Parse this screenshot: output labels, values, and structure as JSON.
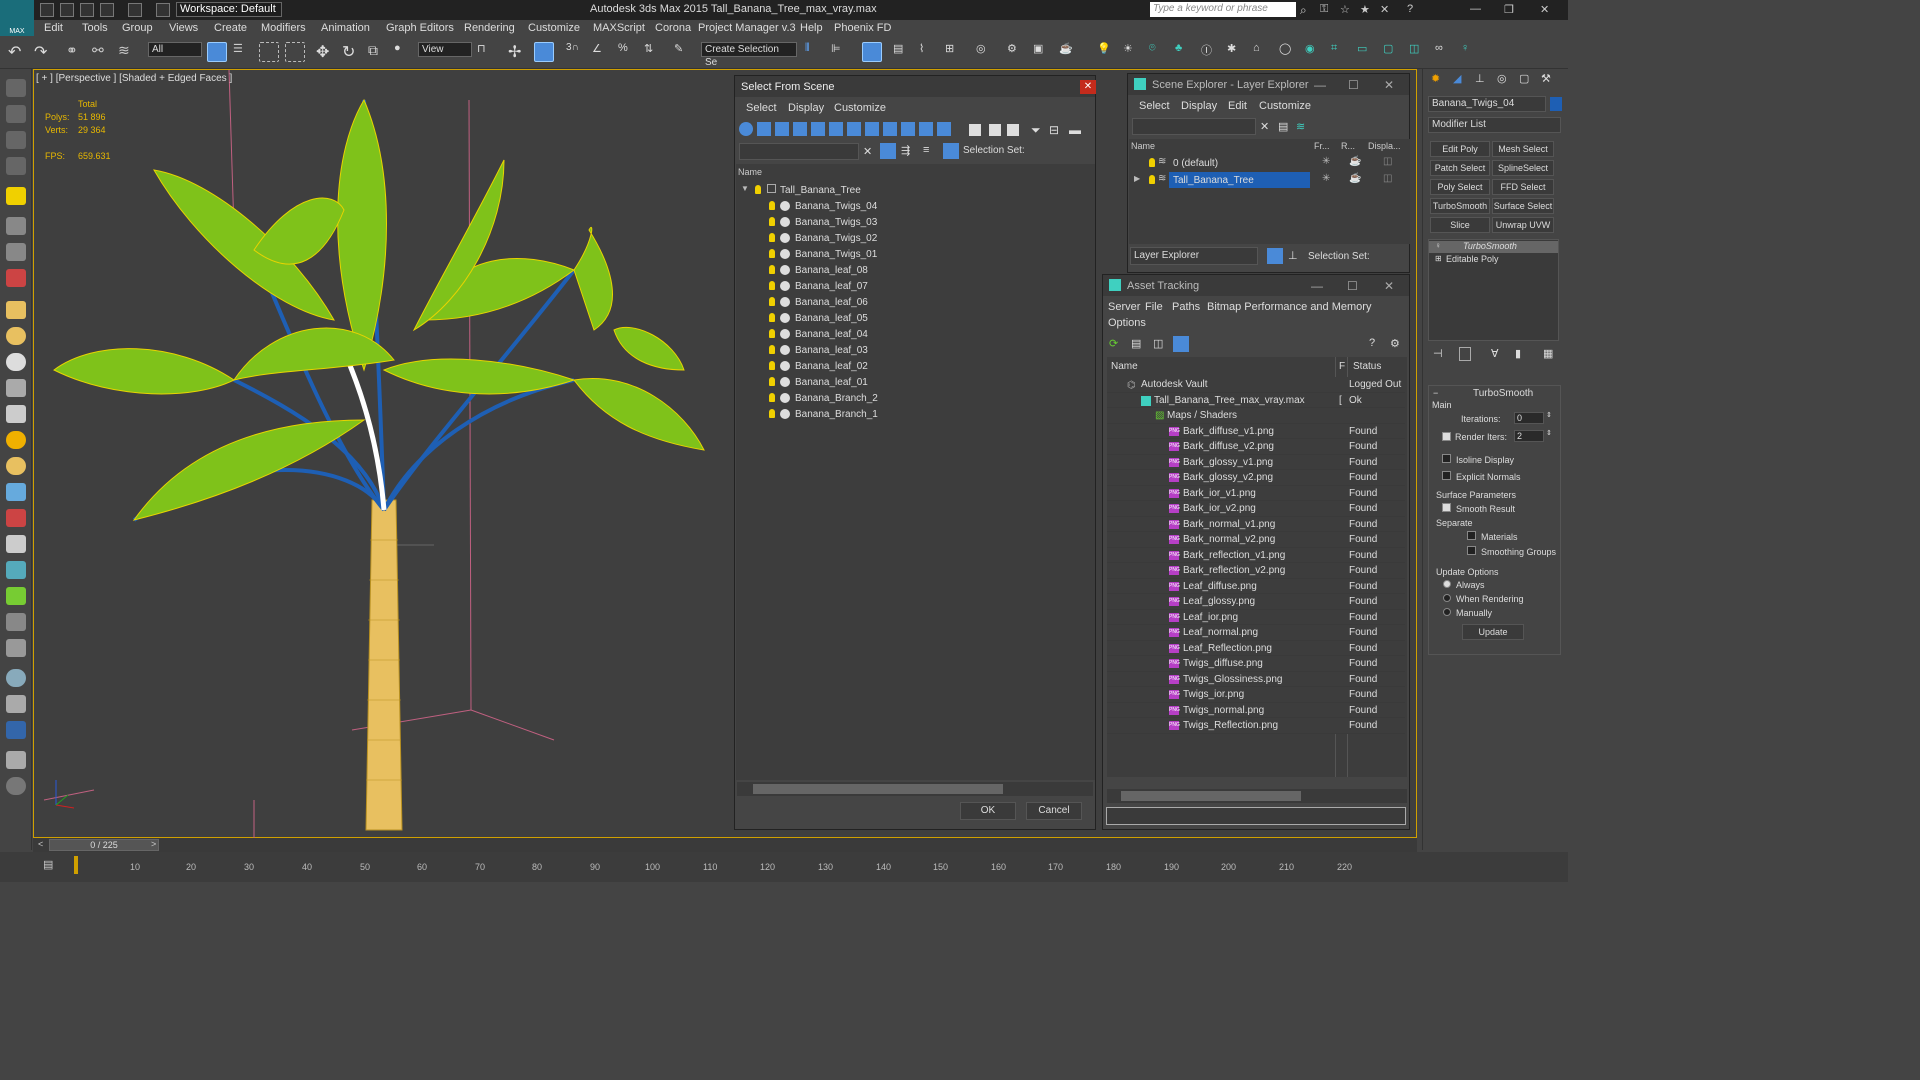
{
  "app": {
    "title": "Autodesk 3ds Max  2015     Tall_Banana_Tree_max_vray.max",
    "logo": "MAX",
    "workspace": "Workspace: Default",
    "search_placeholder": "Type a keyword or phrase"
  },
  "menu": [
    "Edit",
    "Tools",
    "Group",
    "Views",
    "Create",
    "Modifiers",
    "Animation",
    "Graph Editors",
    "Rendering",
    "Customize",
    "MAXScript",
    "Corona",
    "Project Manager v.3",
    "Help",
    "Phoenix FD"
  ],
  "toolbar": {
    "filter": "All",
    "view": "View",
    "selection_set": "Create Selection Se"
  },
  "viewport": {
    "label": "[ + ] [Perspective ] [Shaded + Edged Faces ]",
    "stats": {
      "total_label": "Total",
      "polys_label": "Polys:",
      "polys": "51 896",
      "verts_label": "Verts:",
      "verts": "29 364",
      "fps_label": "FPS:",
      "fps": "659.631"
    }
  },
  "select_from_scene": {
    "title": "Select From Scene",
    "menu": [
      "Select",
      "Display",
      "Customize"
    ],
    "selection_set_label": "Selection Set:",
    "column_name": "Name",
    "root": "Tall_Banana_Tree",
    "items": [
      "Banana_Twigs_04",
      "Banana_Twigs_03",
      "Banana_Twigs_02",
      "Banana_Twigs_01",
      "Banana_leaf_08",
      "Banana_leaf_07",
      "Banana_leaf_06",
      "Banana_leaf_05",
      "Banana_leaf_04",
      "Banana_leaf_03",
      "Banana_leaf_02",
      "Banana_leaf_01",
      "Banana_Branch_2",
      "Banana_Branch_1"
    ],
    "ok": "OK",
    "cancel": "Cancel"
  },
  "scene_explorer": {
    "title": "Scene Explorer - Layer Explorer",
    "menu": [
      "Select",
      "Display",
      "Edit",
      "Customize"
    ],
    "columns": [
      "Name",
      "Fr...",
      "R...",
      "Displa..."
    ],
    "layers": [
      "0 (default)",
      "Tall_Banana_Tree"
    ],
    "footer_dropdown": "Layer Explorer",
    "selection_set_label": "Selection Set:"
  },
  "asset_tracking": {
    "title": "Asset Tracking",
    "menu": [
      "Server",
      "File",
      "Paths",
      "Bitmap Performance and Memory"
    ],
    "menu2": "Options",
    "columns": [
      "Name",
      "F",
      "Status"
    ],
    "vault": {
      "name": "Autodesk Vault",
      "status": "Logged Out"
    },
    "file": {
      "name": "Tall_Banana_Tree_max_vray.max",
      "flag": "[",
      "status": "Ok"
    },
    "maps_label": "Maps / Shaders",
    "png_badge": "PNG",
    "maps": [
      {
        "name": "Bark_diffuse_v1.png",
        "status": "Found"
      },
      {
        "name": "Bark_diffuse_v2.png",
        "status": "Found"
      },
      {
        "name": "Bark_glossy_v1.png",
        "status": "Found"
      },
      {
        "name": "Bark_glossy_v2.png",
        "status": "Found"
      },
      {
        "name": "Bark_ior_v1.png",
        "status": "Found"
      },
      {
        "name": "Bark_ior_v2.png",
        "status": "Found"
      },
      {
        "name": "Bark_normal_v1.png",
        "status": "Found"
      },
      {
        "name": "Bark_normal_v2.png",
        "status": "Found"
      },
      {
        "name": "Bark_reflection_v1.png",
        "status": "Found"
      },
      {
        "name": "Bark_reflection_v2.png",
        "status": "Found"
      },
      {
        "name": "Leaf_diffuse.png",
        "status": "Found"
      },
      {
        "name": "Leaf_glossy.png",
        "status": "Found"
      },
      {
        "name": "Leaf_ior.png",
        "status": "Found"
      },
      {
        "name": "Leaf_normal.png",
        "status": "Found"
      },
      {
        "name": "Leaf_Reflection.png",
        "status": "Found"
      },
      {
        "name": "Twigs_diffuse.png",
        "status": "Found"
      },
      {
        "name": "Twigs_Glossiness.png",
        "status": "Found"
      },
      {
        "name": "Twigs_ior.png",
        "status": "Found"
      },
      {
        "name": "Twigs_normal.png",
        "status": "Found"
      },
      {
        "name": "Twigs_Reflection.png",
        "status": "Found"
      }
    ]
  },
  "command_panel": {
    "object_name": "Banana_Twigs_04",
    "modifier_list": "Modifier List",
    "buttons": [
      "Edit Poly",
      "Mesh Select",
      "Patch Select",
      "SplineSelect",
      "Poly Select",
      "FFD Select",
      "TurboSmooth",
      "Surface Select",
      "Slice",
      "Unwrap UVW"
    ],
    "stack": [
      "TurboSmooth",
      "Editable Poly"
    ],
    "rollout_title": "TurboSmooth",
    "main_label": "Main",
    "iterations_label": "Iterations:",
    "iterations": "0",
    "render_iters_label": "Render Iters:",
    "render_iters": "2",
    "isoline": "Isoline Display",
    "explicit_normals": "Explicit Normals",
    "surface_params": "Surface Parameters",
    "smooth_result": "Smooth Result",
    "separate": "Separate",
    "materials": "Materials",
    "smoothing_groups": "Smoothing Groups",
    "update_options": "Update Options",
    "always": "Always",
    "when_rendering": "When Rendering",
    "manually": "Manually",
    "update": "Update"
  },
  "timeline": {
    "frame": "0 / 225",
    "ticks": [
      "10",
      "20",
      "30",
      "40",
      "50",
      "60",
      "70",
      "80",
      "90",
      "100",
      "110",
      "120",
      "130",
      "140",
      "150",
      "160",
      "170",
      "180",
      "190",
      "200",
      "210",
      "220"
    ]
  },
  "colors": {
    "accent_blue": "#1e5fb4",
    "leaf_green": "#7fc21a",
    "wire_yellow": "#e8d400",
    "viewport_border": "#d0a000",
    "close_red": "#c42b1c"
  }
}
